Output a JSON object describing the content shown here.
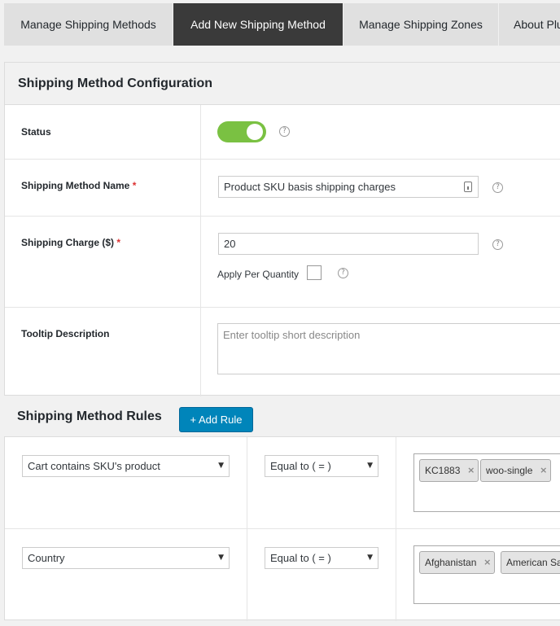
{
  "tabs": [
    {
      "label": "Manage Shipping Methods",
      "active": false
    },
    {
      "label": "Add New Shipping Method",
      "active": true
    },
    {
      "label": "Manage Shipping Zones",
      "active": false
    },
    {
      "label": "About Plu",
      "active": false
    }
  ],
  "config": {
    "title": "Shipping Method Configuration",
    "status": {
      "label": "Status",
      "enabled": true
    },
    "method_name": {
      "label": "Shipping Method Name",
      "required_mark": "*",
      "value": "Product SKU basis shipping charges"
    },
    "charge": {
      "label": "Shipping Charge ($)",
      "required_mark": "*",
      "value": "20"
    },
    "apply_per_quantity": {
      "label": "Apply Per Quantity",
      "checked": false
    },
    "tooltip": {
      "label": "Tooltip Description",
      "placeholder": "Enter tooltip short description"
    },
    "help_glyph": "?"
  },
  "rules": {
    "title": "Shipping Method Rules",
    "add_button": "+ Add Rule",
    "rows": [
      {
        "condition": "Cart contains SKU's product",
        "operator": "Equal to ( = )",
        "tags": [
          "KC1883",
          "woo-single"
        ]
      },
      {
        "condition": "Country",
        "operator": "Equal to ( = )",
        "tags": [
          "Afghanistan",
          "American Sa"
        ]
      }
    ],
    "tag_remove_glyph": "×",
    "caret_glyph": "▼"
  },
  "colors": {
    "accent": "#0085ba",
    "toggle_on": "#7ac142",
    "active_tab": "#3a3a3a",
    "required": "#dc3232"
  }
}
